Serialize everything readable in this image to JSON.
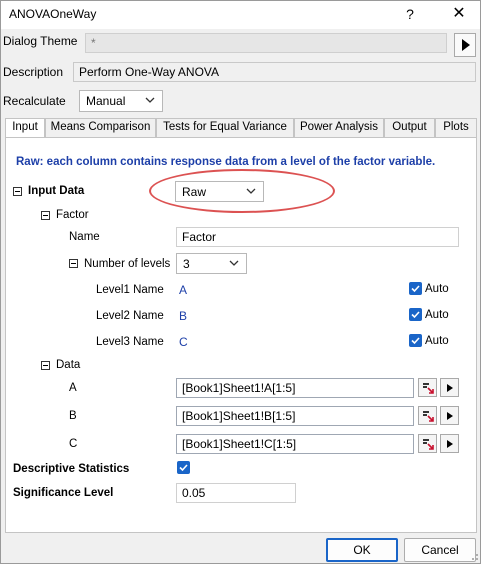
{
  "window": {
    "title": "ANOVAOneWay",
    "help_glyph": "?",
    "close_glyph": "✕"
  },
  "dialog_theme": {
    "label": "Dialog Theme",
    "value": "*"
  },
  "description": {
    "label": "Description",
    "value": "Perform One-Way ANOVA"
  },
  "recalculate": {
    "label": "Recalculate",
    "value": "Manual"
  },
  "tabs": [
    {
      "label": "Input",
      "active": true
    },
    {
      "label": "Means Comparison"
    },
    {
      "label": "Tests for Equal Variance"
    },
    {
      "label": "Power Analysis"
    },
    {
      "label": "Output"
    },
    {
      "label": "Plots"
    }
  ],
  "info_text": "Raw: each column contains response data from a level of the factor variable.",
  "input_data": {
    "label": "Input Data",
    "value": "Raw",
    "factor": {
      "label": "Factor",
      "name_label": "Name",
      "name_value": "Factor",
      "num_levels_label": "Number of levels",
      "num_levels_value": "3",
      "levels": [
        {
          "label": "Level1 Name",
          "value": "A",
          "auto_label": "Auto",
          "auto": true
        },
        {
          "label": "Level2 Name",
          "value": "B",
          "auto_label": "Auto",
          "auto": true
        },
        {
          "label": "Level3 Name",
          "value": "C",
          "auto_label": "Auto",
          "auto": true
        }
      ]
    },
    "data": {
      "label": "Data",
      "rows": [
        {
          "label": "A",
          "range": "[Book1]Sheet1!A[1:5]"
        },
        {
          "label": "B",
          "range": "[Book1]Sheet1!B[1:5]"
        },
        {
          "label": "C",
          "range": "[Book1]Sheet1!C[1:5]"
        }
      ]
    }
  },
  "descriptive_statistics": {
    "label": "Descriptive Statistics",
    "checked": true
  },
  "significance_level": {
    "label": "Significance Level",
    "value": "0.05"
  },
  "buttons": {
    "ok": "OK",
    "cancel": "Cancel"
  },
  "colors": {
    "accent": "#1a65c8",
    "highlight_ellipse": "#dc5252",
    "info_text": "#1d3fa8"
  }
}
